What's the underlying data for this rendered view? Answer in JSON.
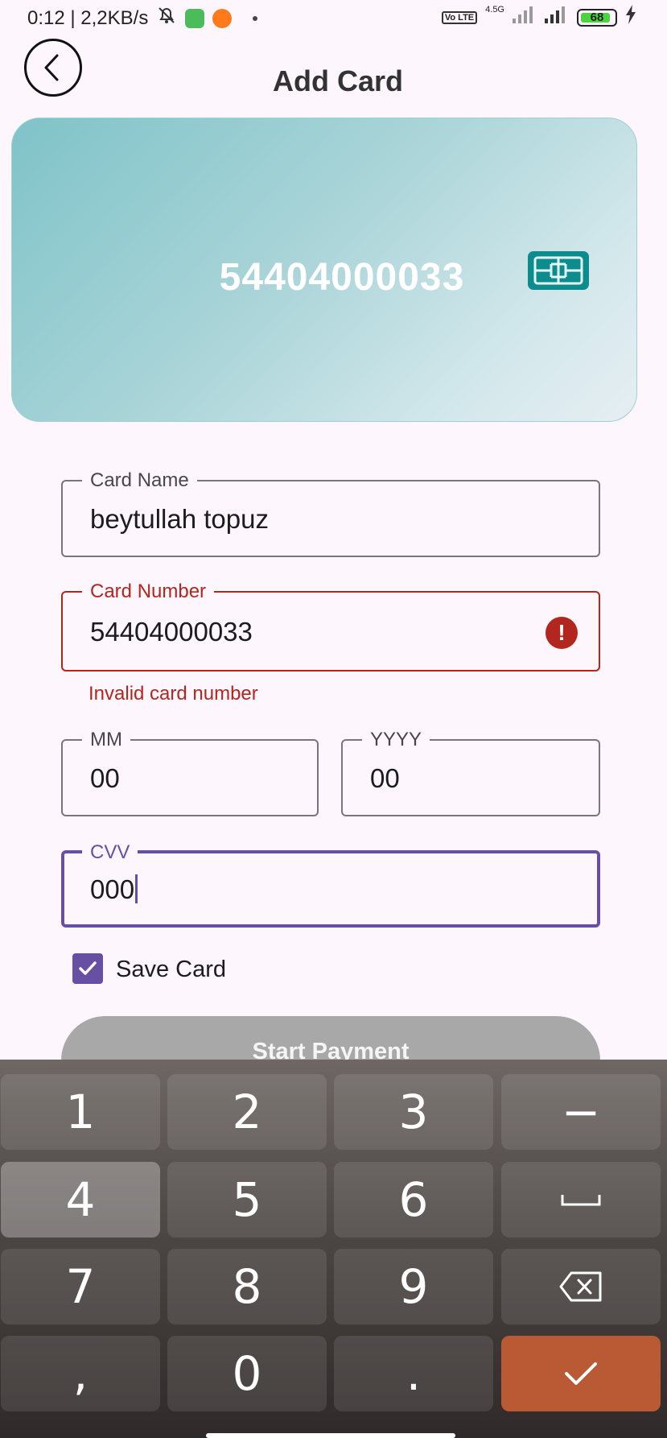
{
  "status_bar": {
    "time_speed": "0:12 | 2,2KB/s",
    "network": "4.5G",
    "volte": "Vo LTE",
    "battery": "68"
  },
  "header": {
    "title": "Add Card"
  },
  "card_preview": {
    "number": "54404000033"
  },
  "form": {
    "card_name": {
      "label": "Card Name",
      "value": "beytullah topuz"
    },
    "card_number": {
      "label": "Card Number",
      "value": "54404000033",
      "error": "Invalid card number"
    },
    "month": {
      "label": "MM",
      "value": "00"
    },
    "year": {
      "label": "YYYY",
      "value": "00"
    },
    "cvv": {
      "label": "CVV",
      "value": "000"
    },
    "save_card": {
      "label": "Save Card",
      "checked": true
    },
    "submit_label": "Start Payment"
  },
  "keyboard": {
    "keys": [
      "1",
      "2",
      "3",
      "−",
      "4",
      "5",
      "6",
      "␣",
      "7",
      "8",
      "9",
      "⌫",
      ",",
      "0",
      ".",
      "✓"
    ]
  },
  "colors": {
    "primary": "#6750a4",
    "error": "#b3261e",
    "done_key": "#b95a35",
    "card_gradient_start": "#7fc3c8"
  }
}
